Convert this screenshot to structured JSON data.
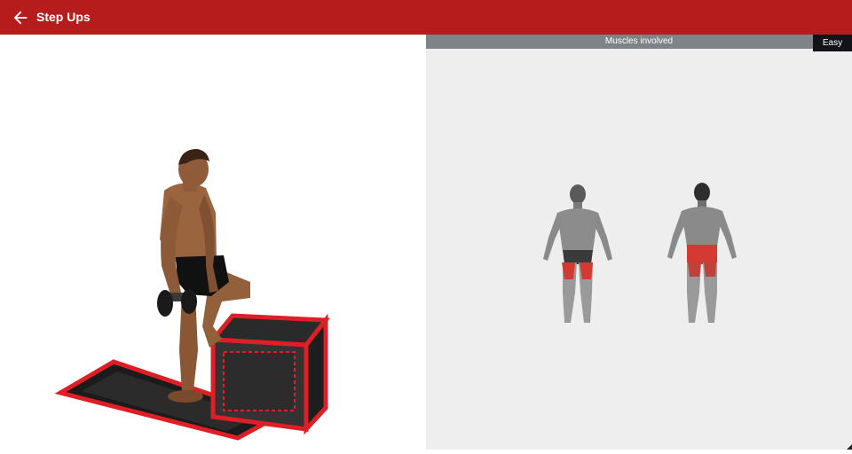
{
  "toolbar": {
    "back_icon": "arrow-left-icon",
    "title": "Step Ups"
  },
  "muscles": {
    "header": "Muscles involved",
    "difficulty": "Easy",
    "highlight_color": "#d23a32"
  },
  "colors": {
    "appbar": "#b71c1c",
    "accent_red": "#e01e26"
  }
}
